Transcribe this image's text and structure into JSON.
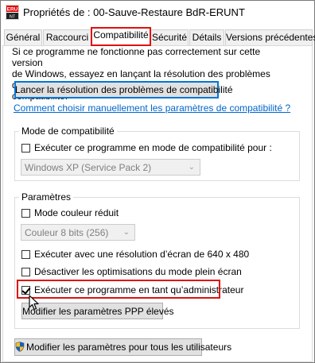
{
  "window": {
    "title": "Propriétés de : 00-Sauve-Restaure BdR-ERUNT",
    "icon": "eru-app-icon"
  },
  "tabs": [
    {
      "label": "Général",
      "active": false
    },
    {
      "label": "Raccourci",
      "active": false
    },
    {
      "label": "Compatibilité",
      "active": true
    },
    {
      "label": "Sécurité",
      "active": false
    },
    {
      "label": "Détails",
      "active": false
    },
    {
      "label": "Versions précédentes",
      "active": false
    }
  ],
  "intro": {
    "line1": "Si ce programme ne fonctionne pas correctement sur cette version",
    "line2": "de Windows, essayez en lançant la résolution des problèmes de",
    "line3": "compatibilité."
  },
  "troubleshoot_button": "Lancer la résolution des problèmes de compatibilité",
  "manual_link": "Comment choisir manuellement les paramètres de compatibilité ?",
  "compat_mode": {
    "title": "Mode de compatibilité",
    "checkbox_label": "Exécuter ce programme en mode de compatibilité pour :",
    "checked": false,
    "select_value": "Windows XP (Service Pack 2)"
  },
  "settings": {
    "title": "Paramètres",
    "reduced_color": {
      "label": "Mode couleur réduit",
      "checked": false
    },
    "color_select": "Couleur 8 bits (256)",
    "res_640": {
      "label": "Exécuter avec une résolution d’écran de 640 x 480",
      "checked": false
    },
    "fullscreen_opt": {
      "label": "Désactiver les optimisations du mode plein écran",
      "checked": false
    },
    "run_admin": {
      "label": "Exécuter ce programme en tant qu’administrateur",
      "checked": true
    },
    "dpi_button": "Modifier les paramètres PPP élevés"
  },
  "all_users_button": "Modifier les paramètres pour tous les utilisateurs",
  "colors": {
    "highlight": "#e01010",
    "link": "#0066cc",
    "accent": "#0078d7"
  }
}
